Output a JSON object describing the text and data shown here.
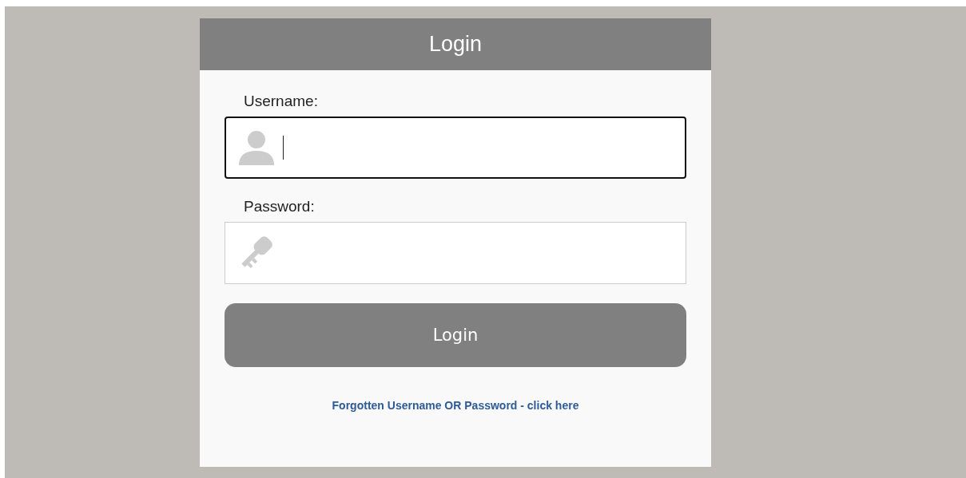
{
  "header": {
    "title": "Login"
  },
  "fields": [
    {
      "kind": "user",
      "label": "Username:",
      "focused": true
    },
    {
      "kind": "key",
      "label": "Password:",
      "focused": false
    }
  ],
  "button": {
    "label": "Login"
  },
  "link": {
    "text": "Forgotten Username OR Password - click here"
  }
}
